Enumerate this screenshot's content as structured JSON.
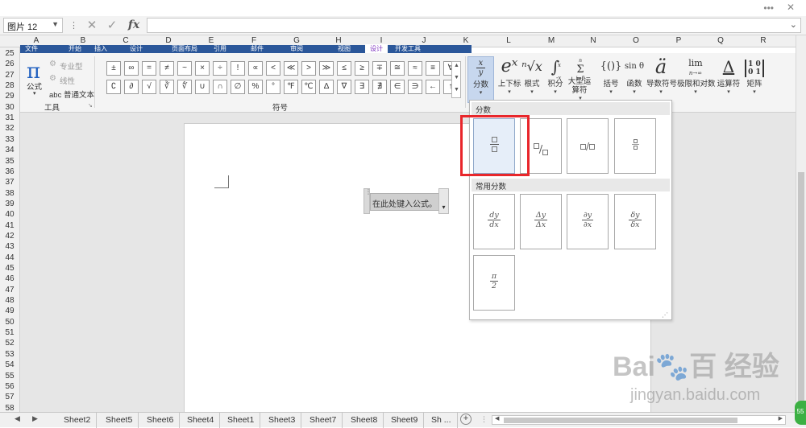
{
  "window": {
    "dots": "•••",
    "close": "✕"
  },
  "formula_bar": {
    "name_box": "图片 12",
    "fx": "fx",
    "formula": ""
  },
  "column_headers": [
    "A",
    "B",
    "C",
    "D",
    "E",
    "F",
    "G",
    "H",
    "I",
    "J",
    "K",
    "L",
    "M",
    "N",
    "O",
    "P",
    "Q",
    "R"
  ],
  "row_headers": [
    "25",
    "26",
    "27",
    "28",
    "29",
    "30",
    "31",
    "32",
    "33",
    "34",
    "35",
    "36",
    "37",
    "38",
    "39",
    "40",
    "41",
    "42",
    "43",
    "44",
    "45",
    "46",
    "47",
    "48",
    "49",
    "50",
    "51",
    "52",
    "53",
    "54",
    "55",
    "56",
    "57",
    "58"
  ],
  "menu_tabs": [
    "文件",
    "开始",
    "插入",
    "设计",
    "页面布局",
    "引用",
    "邮件",
    "审阅",
    "视图",
    "开发工具",
    "设计"
  ],
  "tools_group": {
    "title": "工具",
    "equation_label": "公式",
    "professional": "专业型",
    "linear": "线性",
    "normal_text": "abc 普通文本"
  },
  "symbols_group": {
    "title": "符号",
    "row1": [
      "±",
      "∞",
      "=",
      "≠",
      "~",
      "×",
      "÷",
      "!",
      "∝",
      "<",
      "≪",
      ">",
      "≫",
      "≤",
      "≥",
      "∓",
      "≅",
      "≈",
      "≡",
      "∀"
    ],
    "row2": [
      "∁",
      "∂",
      "√",
      "∛",
      "∜",
      "∪",
      "∩",
      "∅",
      "%",
      "°",
      "℉",
      "℃",
      "∆",
      "∇",
      "∃",
      "∄",
      "∈",
      "∋",
      "←",
      "↑"
    ]
  },
  "structures": [
    {
      "icon": "x/y",
      "label": "分数"
    },
    {
      "icon": "eˣ",
      "label": "上下标"
    },
    {
      "icon": "ⁿ√x",
      "label": "根式"
    },
    {
      "icon": "∫",
      "label": "积分"
    },
    {
      "icon": "Σ",
      "label": "大型运算符"
    },
    {
      "icon": "{()}",
      "label": "括号"
    },
    {
      "icon": "sin θ",
      "label": "函数"
    },
    {
      "icon": "ä",
      "label": "导数符号"
    },
    {
      "icon": "lim",
      "label": "极限和对数"
    },
    {
      "icon": "Δ",
      "label": "运算符"
    },
    {
      "icon": "[10 01]",
      "label": "矩阵"
    }
  ],
  "structures_icon_extra": {
    "sum_top": "n",
    "sum_bot": "i=0",
    "int_top": "x",
    "int_bot": "-x",
    "lim_sub": "n→∞"
  },
  "equation_placeholder": "在此处键入公式。",
  "gallery": {
    "section1": "分数",
    "section2": "常用分数",
    "common": [
      {
        "num": "dy",
        "den": "dx"
      },
      {
        "num": "Δy",
        "den": "Δx"
      },
      {
        "num": "∂y",
        "den": "∂x"
      },
      {
        "num": "δy",
        "den": "δx"
      },
      {
        "num": "π",
        "den": "2"
      }
    ],
    "skewed_sep": "/",
    "linear_sep": "/"
  },
  "sheet_tabs": [
    "Sheet2",
    "Sheet5",
    "Sheet6",
    "Sheet4",
    "Sheet1",
    "Sheet3",
    "Sheet7",
    "Sheet8",
    "Sheet9",
    "Sh ..."
  ],
  "watermark": {
    "brand": "Bai🐾百 经验",
    "url": "jingyan.baidu.com"
  },
  "badge": "55",
  "colors": {
    "ribbon_blue": "#2b579a",
    "highlight_red": "#e8262b",
    "active_btn": "#c7d7ee"
  }
}
